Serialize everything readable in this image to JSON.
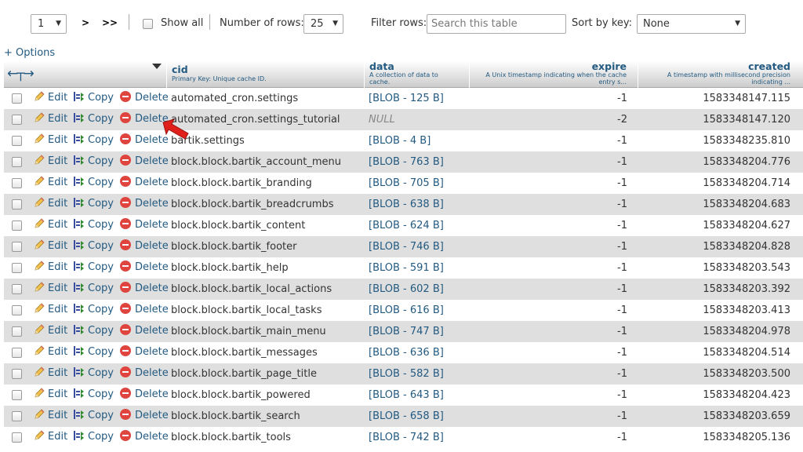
{
  "navigation": {
    "page_value": "1",
    "next_label": ">",
    "last_label": ">>",
    "show_all_label": "Show all",
    "number_of_rows_label": "Number of rows:",
    "rows_value": "25",
    "filter_rows_label": "Filter rows:",
    "filter_placeholder": "Search this table",
    "sort_by_key_label": "Sort by key:",
    "sort_value": "None"
  },
  "options_label": "+ Options",
  "columns": {
    "cid": {
      "title": "cid",
      "comment": "Primary Key: Unique cache ID."
    },
    "data": {
      "title": "data",
      "comment": "A collection of data to cache."
    },
    "expire": {
      "title": "expire",
      "comment": "A Unix timestamp indicating when the cache entry s..."
    },
    "created": {
      "title": "created",
      "comment": "A timestamp with millisecond precision indicating ..."
    }
  },
  "actions": {
    "edit": "Edit",
    "copy": "Copy",
    "delete": "Delete"
  },
  "rows": [
    {
      "cid": "automated_cron.settings",
      "data": "[BLOB - 125 B]",
      "expire": "-1",
      "created": "1583348147.115"
    },
    {
      "cid": "automated_cron.settings_tutorial",
      "data": "NULL",
      "expire": "-2",
      "created": "1583348147.120"
    },
    {
      "cid": "bartik.settings",
      "data": "[BLOB - 4 B]",
      "expire": "-1",
      "created": "1583348235.810"
    },
    {
      "cid": "block.block.bartik_account_menu",
      "data": "[BLOB - 763 B]",
      "expire": "-1",
      "created": "1583348204.776"
    },
    {
      "cid": "block.block.bartik_branding",
      "data": "[BLOB - 705 B]",
      "expire": "-1",
      "created": "1583348204.714"
    },
    {
      "cid": "block.block.bartik_breadcrumbs",
      "data": "[BLOB - 638 B]",
      "expire": "-1",
      "created": "1583348204.683"
    },
    {
      "cid": "block.block.bartik_content",
      "data": "[BLOB - 624 B]",
      "expire": "-1",
      "created": "1583348204.627"
    },
    {
      "cid": "block.block.bartik_footer",
      "data": "[BLOB - 746 B]",
      "expire": "-1",
      "created": "1583348204.828"
    },
    {
      "cid": "block.block.bartik_help",
      "data": "[BLOB - 591 B]",
      "expire": "-1",
      "created": "1583348203.543"
    },
    {
      "cid": "block.block.bartik_local_actions",
      "data": "[BLOB - 602 B]",
      "expire": "-1",
      "created": "1583348203.392"
    },
    {
      "cid": "block.block.bartik_local_tasks",
      "data": "[BLOB - 616 B]",
      "expire": "-1",
      "created": "1583348203.413"
    },
    {
      "cid": "block.block.bartik_main_menu",
      "data": "[BLOB - 747 B]",
      "expire": "-1",
      "created": "1583348204.978"
    },
    {
      "cid": "block.block.bartik_messages",
      "data": "[BLOB - 636 B]",
      "expire": "-1",
      "created": "1583348204.514"
    },
    {
      "cid": "block.block.bartik_page_title",
      "data": "[BLOB - 582 B]",
      "expire": "-1",
      "created": "1583348203.500"
    },
    {
      "cid": "block.block.bartik_powered",
      "data": "[BLOB - 643 B]",
      "expire": "-1",
      "created": "1583348204.423"
    },
    {
      "cid": "block.block.bartik_search",
      "data": "[BLOB - 658 B]",
      "expire": "-1",
      "created": "1583348203.659"
    },
    {
      "cid": "block.block.bartik_tools",
      "data": "[BLOB - 742 B]",
      "expire": "-1",
      "created": "1583348205.136"
    }
  ],
  "colors": {
    "link": "#235a81",
    "row_alt": "#dfdfdf",
    "delete_icon": "#e0443e",
    "pointer_arrow": "#e0201b"
  }
}
